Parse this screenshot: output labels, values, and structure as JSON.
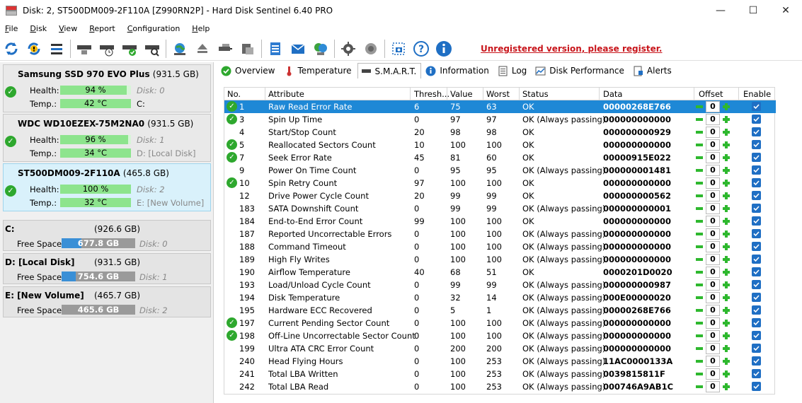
{
  "window": {
    "title": "Disk: 2, ST500DM009-2F110A [Z990RN2P]  -  Hard Disk Sentinel 6.40 PRO",
    "minimize": "—",
    "maximize": "☐",
    "close": "✕"
  },
  "menu": [
    {
      "label": "File",
      "key": "F"
    },
    {
      "label": "Disk",
      "key": "D"
    },
    {
      "label": "View",
      "key": "V"
    },
    {
      "label": "Report",
      "key": "R"
    },
    {
      "label": "Configuration",
      "key": "C"
    },
    {
      "label": "Help",
      "key": "H"
    }
  ],
  "register_text": "Unregistered version, please register.",
  "colors": {
    "accent": "#1e88d6",
    "health": "#8de48d",
    "register": "#c8151b",
    "volume": "#3a8fd6"
  },
  "disks": [
    {
      "name": "Samsung SSD 970 EVO Plus",
      "size": "(931.5 GB)",
      "health_label": "Health:",
      "health": "94 %",
      "health_fraction": 0.94,
      "disk_label": "Disk: 0",
      "temp_label": "Temp.:",
      "temp": "42 °C",
      "volume": "C:"
    },
    {
      "name": "WDC WD10EZEX-75M2NA0",
      "size": "(931.5 GB)",
      "health_label": "Health:",
      "health": "96 %",
      "health_fraction": 0.96,
      "disk_label": "Disk: 1",
      "temp_label": "Temp.:",
      "temp": "34 °C",
      "volume": "D: [Local Disk]"
    },
    {
      "name": "ST500DM009-2F110A",
      "size": "(465.8 GB)",
      "health_label": "Health:",
      "health": "100 %",
      "health_fraction": 1.0,
      "disk_label": "Disk: 2",
      "temp_label": "Temp.:",
      "temp": "32 °C",
      "volume": "E: [New Volume]"
    }
  ],
  "volumes": [
    {
      "name": "C:",
      "size": "(926.6 GB)",
      "free_label": "Free Space",
      "free": "677.8 GB",
      "used_fraction": 0.27,
      "disk": "Disk: 0"
    },
    {
      "name": "D: [Local Disk]",
      "size": "(931.5 GB)",
      "free_label": "Free Space",
      "free": "754.6 GB",
      "used_fraction": 0.19,
      "disk": "Disk: 1"
    },
    {
      "name": "E: [New Volume]",
      "size": "(465.7 GB)",
      "free_label": "Free Space",
      "free": "465.6 GB",
      "used_fraction": 0.0,
      "disk": "Disk: 2"
    }
  ],
  "tabs": [
    {
      "label": "Overview",
      "icon": "check-icon"
    },
    {
      "label": "Temperature",
      "icon": "thermometer-icon"
    },
    {
      "label": "S.M.A.R.T.",
      "icon": "disk-icon"
    },
    {
      "label": "Information",
      "icon": "info-icon"
    },
    {
      "label": "Log",
      "icon": "log-icon"
    },
    {
      "label": "Disk Performance",
      "icon": "chart-icon"
    },
    {
      "label": "Alerts",
      "icon": "alert-icon"
    }
  ],
  "smart": {
    "columns": [
      "No.",
      "Attribute",
      "Thresh...",
      "Value",
      "Worst",
      "Status",
      "Data",
      "Offset",
      "Enable"
    ],
    "rows": [
      {
        "no": "1",
        "attr": "Raw Read Error Rate",
        "thresh": "6",
        "value": "75",
        "worst": "63",
        "status": "OK",
        "data": "00000268E766",
        "offset": "0",
        "check": true
      },
      {
        "no": "3",
        "attr": "Spin Up Time",
        "thresh": "0",
        "value": "97",
        "worst": "97",
        "status": "OK (Always passing)",
        "data": "000000000000",
        "offset": "0",
        "check": true
      },
      {
        "no": "4",
        "attr": "Start/Stop Count",
        "thresh": "20",
        "value": "98",
        "worst": "98",
        "status": "OK",
        "data": "000000000929",
        "offset": "0",
        "check": false
      },
      {
        "no": "5",
        "attr": "Reallocated Sectors Count",
        "thresh": "10",
        "value": "100",
        "worst": "100",
        "status": "OK",
        "data": "000000000000",
        "offset": "0",
        "check": true
      },
      {
        "no": "7",
        "attr": "Seek Error Rate",
        "thresh": "45",
        "value": "81",
        "worst": "60",
        "status": "OK",
        "data": "00000915E022",
        "offset": "0",
        "check": true
      },
      {
        "no": "9",
        "attr": "Power On Time Count",
        "thresh": "0",
        "value": "95",
        "worst": "95",
        "status": "OK (Always passing)",
        "data": "000000001481",
        "offset": "0",
        "check": false
      },
      {
        "no": "10",
        "attr": "Spin Retry Count",
        "thresh": "97",
        "value": "100",
        "worst": "100",
        "status": "OK",
        "data": "000000000000",
        "offset": "0",
        "check": true
      },
      {
        "no": "12",
        "attr": "Drive Power Cycle Count",
        "thresh": "20",
        "value": "99",
        "worst": "99",
        "status": "OK",
        "data": "000000000562",
        "offset": "0",
        "check": false
      },
      {
        "no": "183",
        "attr": "SATA Downshift Count",
        "thresh": "0",
        "value": "99",
        "worst": "99",
        "status": "OK (Always passing)",
        "data": "000000000001",
        "offset": "0",
        "check": false
      },
      {
        "no": "184",
        "attr": "End-to-End Error Count",
        "thresh": "99",
        "value": "100",
        "worst": "100",
        "status": "OK",
        "data": "000000000000",
        "offset": "0",
        "check": false
      },
      {
        "no": "187",
        "attr": "Reported Uncorrectable Errors",
        "thresh": "0",
        "value": "100",
        "worst": "100",
        "status": "OK (Always passing)",
        "data": "000000000000",
        "offset": "0",
        "check": false
      },
      {
        "no": "188",
        "attr": "Command Timeout",
        "thresh": "0",
        "value": "100",
        "worst": "100",
        "status": "OK (Always passing)",
        "data": "000000000000",
        "offset": "0",
        "check": false
      },
      {
        "no": "189",
        "attr": "High Fly Writes",
        "thresh": "0",
        "value": "100",
        "worst": "100",
        "status": "OK (Always passing)",
        "data": "000000000000",
        "offset": "0",
        "check": false
      },
      {
        "no": "190",
        "attr": "Airflow Temperature",
        "thresh": "40",
        "value": "68",
        "worst": "51",
        "status": "OK",
        "data": "0000201D0020",
        "offset": "0",
        "check": false
      },
      {
        "no": "193",
        "attr": "Load/Unload Cycle Count",
        "thresh": "0",
        "value": "99",
        "worst": "99",
        "status": "OK (Always passing)",
        "data": "000000000987",
        "offset": "0",
        "check": false
      },
      {
        "no": "194",
        "attr": "Disk Temperature",
        "thresh": "0",
        "value": "32",
        "worst": "14",
        "status": "OK (Always passing)",
        "data": "000E00000020",
        "offset": "0",
        "check": false
      },
      {
        "no": "195",
        "attr": "Hardware ECC Recovered",
        "thresh": "0",
        "value": "5",
        "worst": "1",
        "status": "OK (Always passing)",
        "data": "00000268E766",
        "offset": "0",
        "check": false
      },
      {
        "no": "197",
        "attr": "Current Pending Sector Count",
        "thresh": "0",
        "value": "100",
        "worst": "100",
        "status": "OK (Always passing)",
        "data": "000000000000",
        "offset": "0",
        "check": true
      },
      {
        "no": "198",
        "attr": "Off-Line Uncorrectable Sector Count",
        "thresh": "0",
        "value": "100",
        "worst": "100",
        "status": "OK (Always passing)",
        "data": "000000000000",
        "offset": "0",
        "check": true
      },
      {
        "no": "199",
        "attr": "Ultra ATA CRC Error Count",
        "thresh": "0",
        "value": "200",
        "worst": "200",
        "status": "OK (Always passing)",
        "data": "000000000000",
        "offset": "0",
        "check": false
      },
      {
        "no": "240",
        "attr": "Head Flying Hours",
        "thresh": "0",
        "value": "100",
        "worst": "253",
        "status": "OK (Always passing)",
        "data": "11AC0000133A",
        "offset": "0",
        "check": false
      },
      {
        "no": "241",
        "attr": "Total LBA Written",
        "thresh": "0",
        "value": "100",
        "worst": "253",
        "status": "OK (Always passing)",
        "data": "0039815811F",
        "offset": "0",
        "check": false
      },
      {
        "no": "242",
        "attr": "Total LBA Read",
        "thresh": "0",
        "value": "100",
        "worst": "253",
        "status": "OK (Always passing)",
        "data": "000746A9AB1C",
        "offset": "0",
        "check": false
      }
    ]
  }
}
